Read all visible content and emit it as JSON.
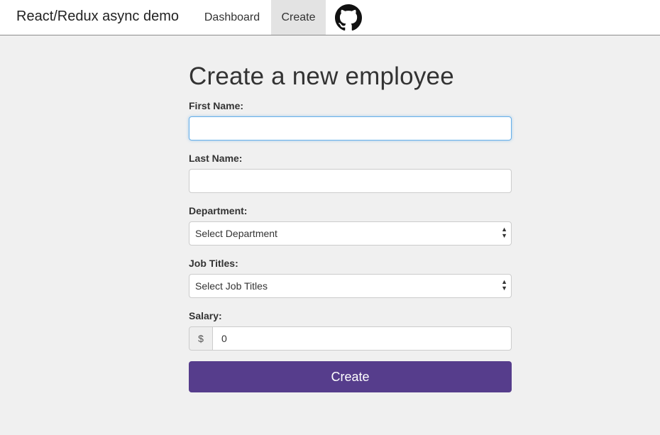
{
  "navbar": {
    "brand": "React/Redux async demo",
    "links": [
      {
        "label": "Dashboard",
        "active": false
      },
      {
        "label": "Create",
        "active": true
      }
    ],
    "github_icon": "github-icon"
  },
  "form": {
    "title": "Create a new employee",
    "first_name": {
      "label": "First Name:",
      "value": ""
    },
    "last_name": {
      "label": "Last Name:",
      "value": ""
    },
    "department": {
      "label": "Department:",
      "selected": "Select Department"
    },
    "job_titles": {
      "label": "Job Titles:",
      "selected": "Select Job Titles"
    },
    "salary": {
      "label": "Salary:",
      "prefix": "$",
      "value": "0"
    },
    "submit_label": "Create"
  },
  "colors": {
    "primary_button": "#563d8c",
    "background": "#f0f0f0",
    "active_nav": "#e3e3e3",
    "focus_border": "#66afe9"
  }
}
